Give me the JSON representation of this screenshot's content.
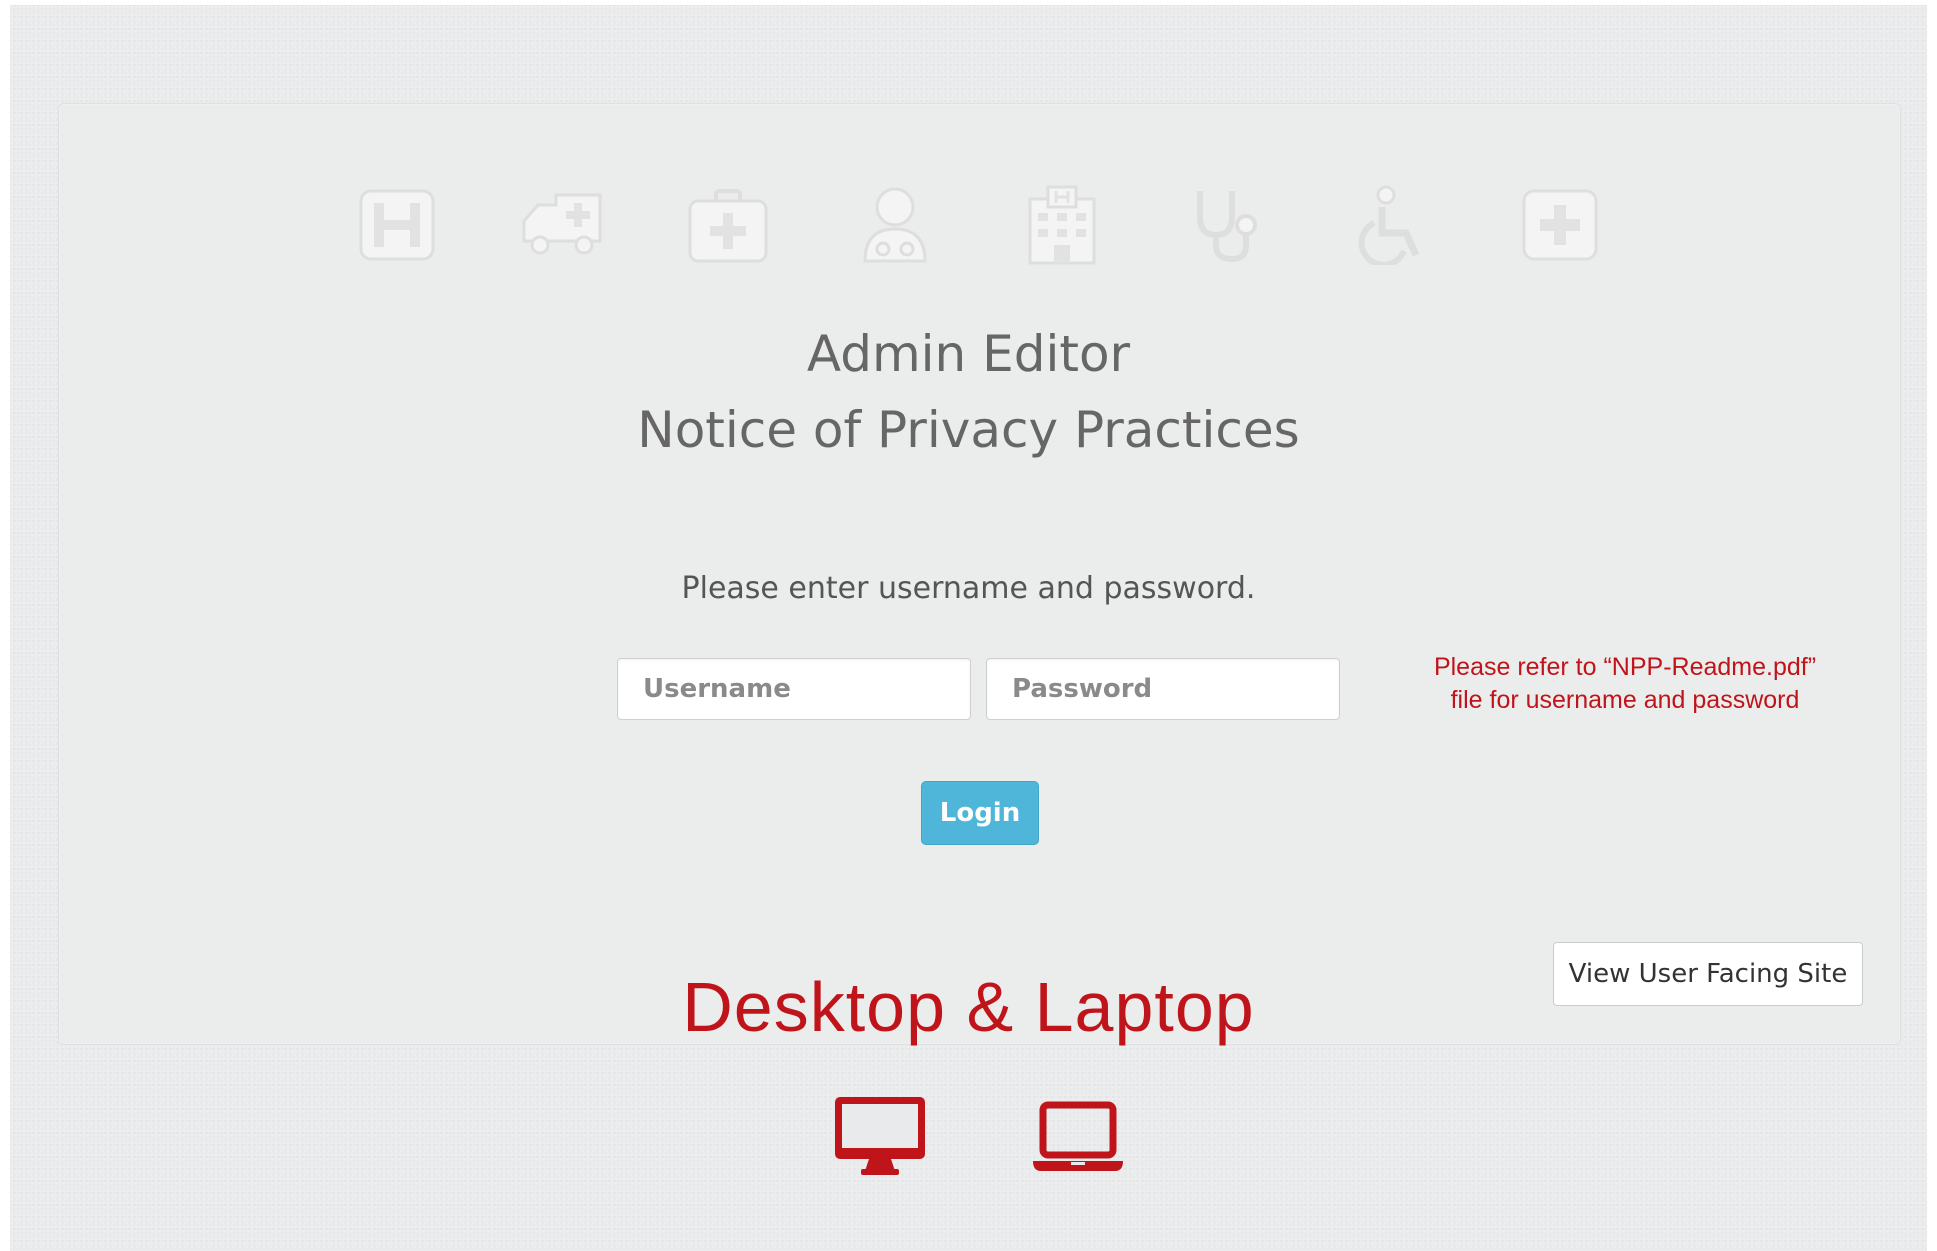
{
  "header": {
    "icons": [
      "hospital-h-icon",
      "ambulance-icon",
      "medkit-icon",
      "user-md-icon",
      "hospital-building-icon",
      "stethoscope-icon",
      "wheelchair-icon",
      "plus-square-icon"
    ],
    "title_line1": "Admin Editor",
    "title_line2": "Notice of Privacy Practices"
  },
  "login": {
    "prompt": "Please enter username and password.",
    "username_placeholder": "Username",
    "password_placeholder": "Password",
    "login_label": "Login"
  },
  "note": {
    "line1": "Please refer  to “NPP-Readme.pdf”",
    "line2": "file for username and password"
  },
  "view_site_label": "View User Facing Site",
  "device_label": "Desktop & Laptop",
  "device_icons": [
    "desktop-icon",
    "laptop-icon"
  ],
  "colors": {
    "accent_red": "#c0141b",
    "login_blue": "#4fb6d9",
    "background": "#e9eaeb",
    "icon_ghost": "#f2f2f2"
  }
}
